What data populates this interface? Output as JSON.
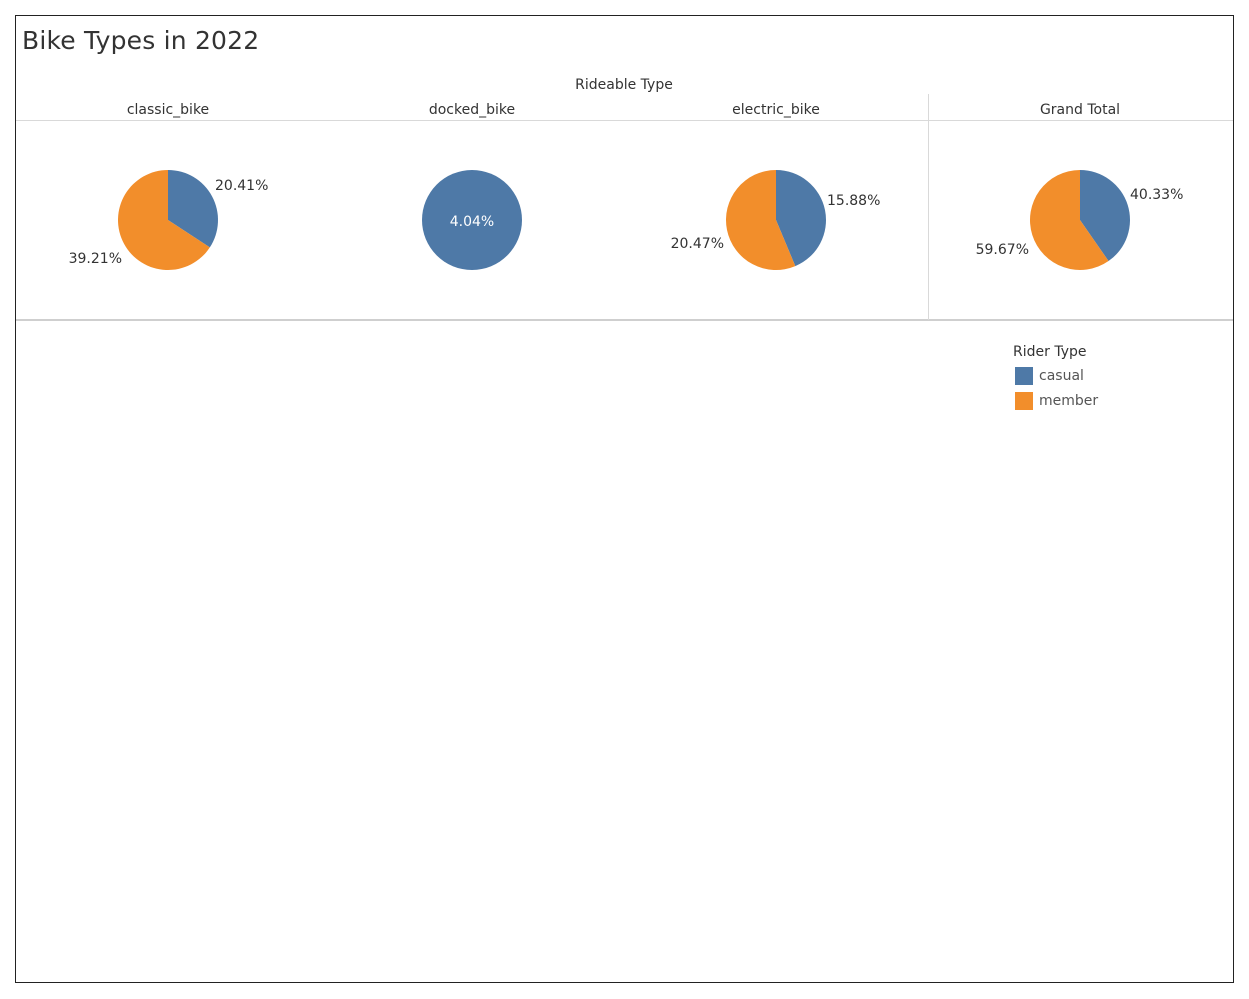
{
  "title": "Bike Types in 2022",
  "colors": {
    "casual": "#4E79A7",
    "member": "#F28E2B"
  },
  "legend": {
    "title": "Rider Type",
    "items": [
      {
        "label": "casual",
        "color": "#4E79A7"
      },
      {
        "label": "member",
        "color": "#F28E2B"
      }
    ]
  },
  "chart_data": {
    "type": "pie",
    "column_header_title": "Rideable Type",
    "grid": false,
    "legend_position": "right",
    "panels": [
      {
        "name": "classic_bike",
        "slices": [
          {
            "label": "casual",
            "value": 20.41,
            "text": "20.41%"
          },
          {
            "label": "member",
            "value": 39.21,
            "text": "39.21%"
          }
        ]
      },
      {
        "name": "docked_bike",
        "slices": [
          {
            "label": "casual",
            "value": 4.04,
            "text": "4.04%"
          }
        ]
      },
      {
        "name": "electric_bike",
        "slices": [
          {
            "label": "casual",
            "value": 15.88,
            "text": "15.88%"
          },
          {
            "label": "member",
            "value": 20.47,
            "text": "20.47%"
          }
        ]
      },
      {
        "name": "Grand Total",
        "slices": [
          {
            "label": "casual",
            "value": 40.33,
            "text": "40.33%"
          },
          {
            "label": "member",
            "value": 59.67,
            "text": "59.67%"
          }
        ]
      }
    ]
  }
}
